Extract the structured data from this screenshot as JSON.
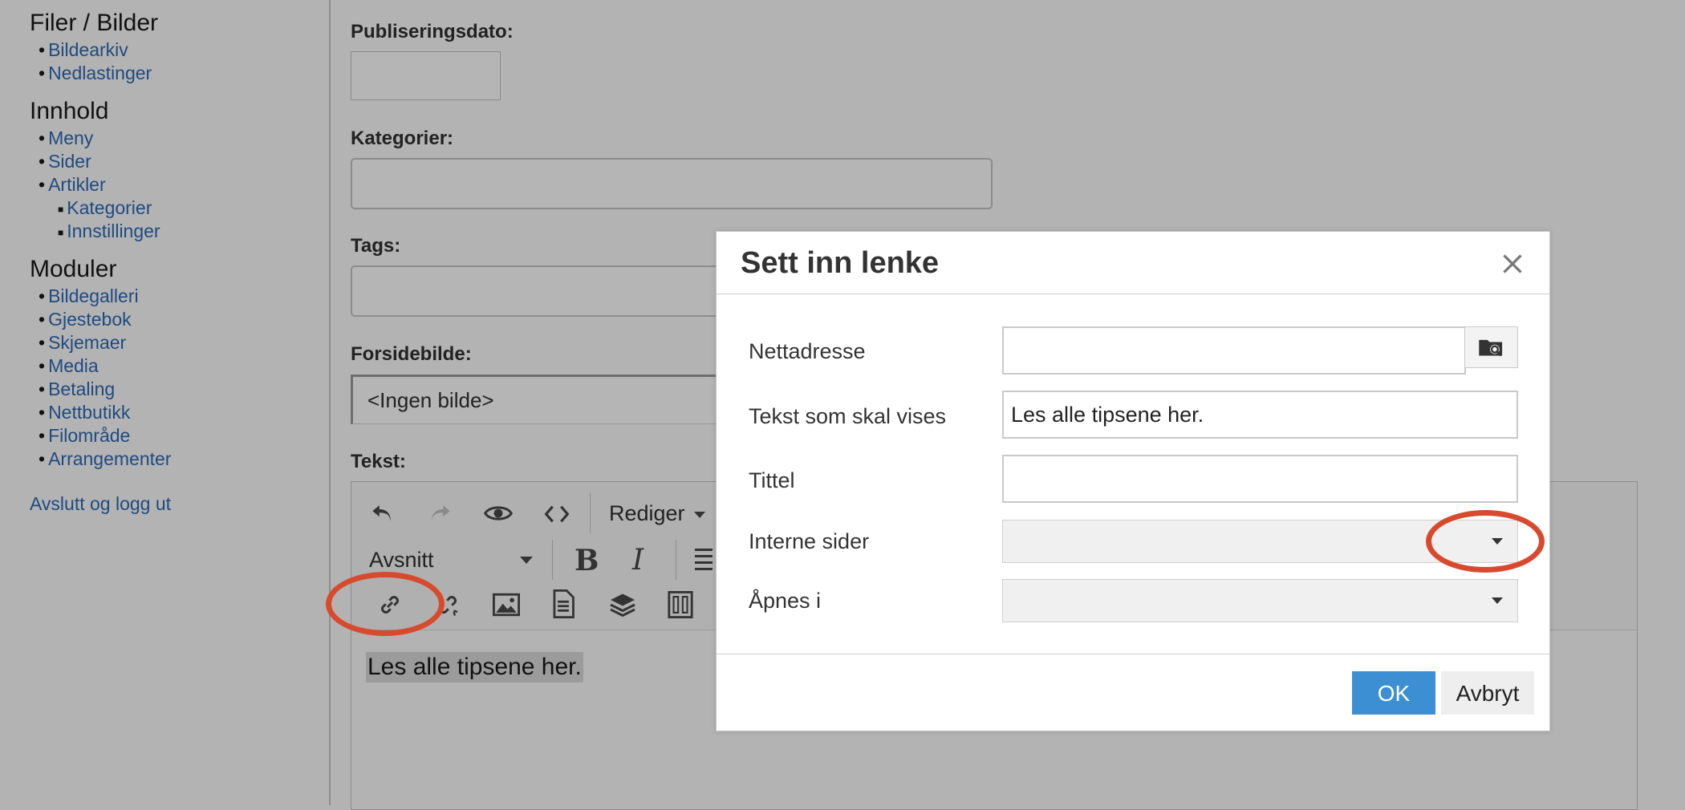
{
  "sidebar": {
    "sections": [
      {
        "title": "Filer / Bilder",
        "items": [
          {
            "label": "Bildearkiv"
          },
          {
            "label": "Nedlastinger"
          }
        ]
      },
      {
        "title": "Innhold",
        "items": [
          {
            "label": "Meny"
          },
          {
            "label": "Sider"
          },
          {
            "label": "Artikler"
          }
        ],
        "subitems": [
          {
            "label": "Kategorier"
          },
          {
            "label": "Innstillinger"
          }
        ]
      },
      {
        "title": "Moduler",
        "items": [
          {
            "label": "Bildegalleri"
          },
          {
            "label": "Gjestebok"
          },
          {
            "label": "Skjemaer"
          },
          {
            "label": "Media"
          },
          {
            "label": "Betaling"
          },
          {
            "label": "Nettbutikk"
          },
          {
            "label": "Filområde"
          },
          {
            "label": "Arrangementer"
          }
        ]
      }
    ],
    "logout": "Avslutt og logg ut"
  },
  "form": {
    "publish_date_label": "Publiseringsdato:",
    "categories_label": "Kategorier:",
    "tags_label": "Tags:",
    "front_image_label": "Forsidebilde:",
    "front_image_value": "<Ingen bilde>",
    "text_label": "Tekst:"
  },
  "editor": {
    "edit_menu": "Rediger",
    "format_select": "Avsnitt",
    "content": "Les alle tipsene her."
  },
  "dialog": {
    "title": "Sett inn lenke",
    "url_label": "Nettadresse",
    "url_value": "",
    "display_text_label": "Tekst som skal vises",
    "display_text_value": "Les alle tipsene her.",
    "title_label": "Tittel",
    "title_value": "",
    "internal_pages_label": "Interne sider",
    "open_in_label": "Åpnes i",
    "ok": "OK",
    "cancel": "Avbryt"
  },
  "colors": {
    "accent": "#3d8fd3",
    "annotation": "#d84a2e",
    "link": "#1f4a80"
  }
}
